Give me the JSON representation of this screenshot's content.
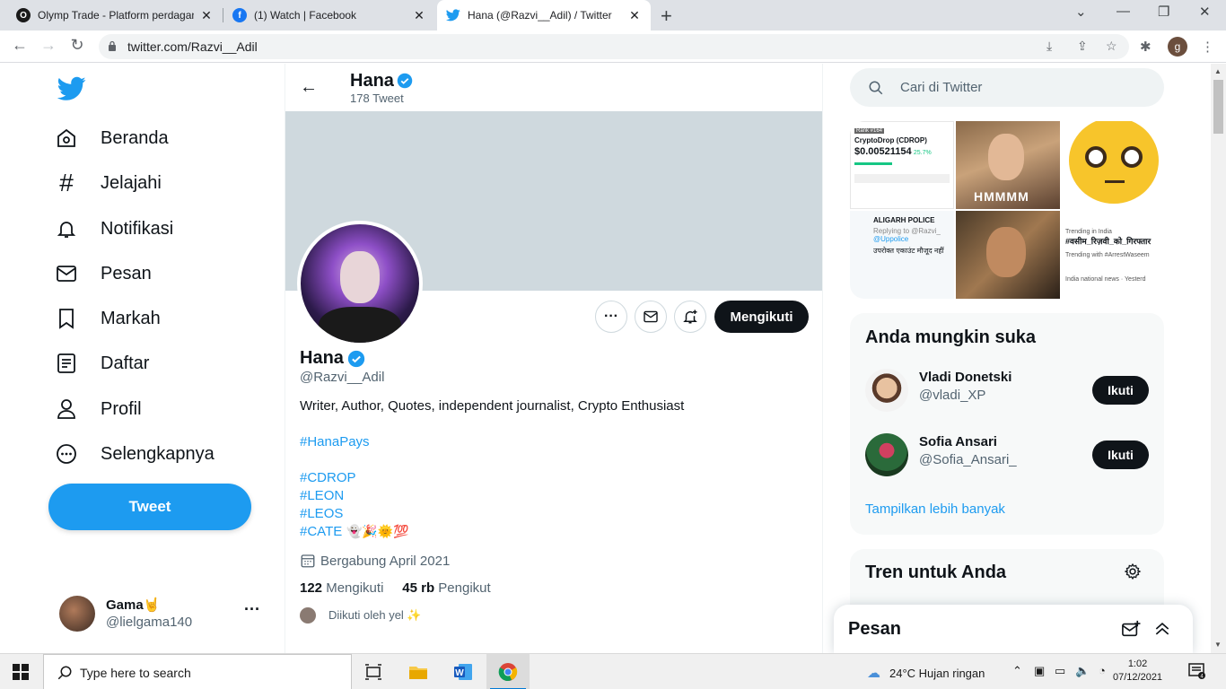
{
  "browser": {
    "tabs": [
      {
        "title": "Olymp Trade - Platform perdagangan",
        "icon": "olymp-icon"
      },
      {
        "title": "(1) Watch | Facebook",
        "icon": "facebook-icon"
      },
      {
        "title": "Hana (@Razvi__Adil) / Twitter",
        "icon": "twitter-icon"
      }
    ],
    "url": "twitter.com/Razvi__Adil",
    "profile_initial": "g"
  },
  "nav": {
    "items": [
      {
        "label": "Beranda",
        "icon": "home-icon"
      },
      {
        "label": "Jelajahi",
        "icon": "hashtag-icon"
      },
      {
        "label": "Notifikasi",
        "icon": "bell-icon"
      },
      {
        "label": "Pesan",
        "icon": "mail-icon"
      },
      {
        "label": "Markah",
        "icon": "bookmark-icon"
      },
      {
        "label": "Daftar",
        "icon": "list-icon"
      },
      {
        "label": "Profil",
        "icon": "user-icon"
      },
      {
        "label": "Selengkapnya",
        "icon": "more-circle-icon"
      }
    ],
    "tweet_label": "Tweet",
    "account": {
      "name": "Gama🤘",
      "handle": "@lielgama140"
    }
  },
  "profile": {
    "header_name": "Hana",
    "tweet_count": "178 Tweet",
    "name": "Hana",
    "handle": "@Razvi__Adil",
    "bio": "Writer, Author, Quotes, independent journalist, Crypto Enthusiast",
    "hashtags": [
      "#HanaPays",
      "#CDROP",
      "#LEON",
      "#LEOS",
      "#CATE"
    ],
    "cate_emoji": "👻🎉🌞💯",
    "joined": "Bergabung April 2021",
    "following_count": "122",
    "following_label": "Mengikuti",
    "followers_count": "45 rb",
    "followers_label": "Pengikut",
    "followed_by": "Diikuti oleh yel ✨",
    "following_button": "Mengikuti"
  },
  "sidebar": {
    "search_placeholder": "Cari di Twitter",
    "media": {
      "crypto_rank": "Rank #164",
      "crypto_name": "CryptoDrop (CDROP)",
      "crypto_price": "$0.00521154",
      "crypto_change": "25.7%",
      "hmmm": "HMMMM",
      "police_name": "ALIGARH POLICE",
      "police_reply": "Replying to @Razvi_",
      "police_mention": "@Uppolice",
      "police_text": "उपरोक्त एकाउंट मौजूद नहीं",
      "trend_label": "Trending in India",
      "trend_tag": "#वसीम_रिज़वी_को_गिरफ्तार",
      "trend_with": "Trending with #ArrestWaseem",
      "trend_news": "India national news · Yesterd"
    },
    "who_to_follow": {
      "title": "Anda mungkin suka",
      "users": [
        {
          "name": "Vladi Donetski",
          "handle": "@vladi_XP",
          "button": "Ikuti"
        },
        {
          "name": "Sofia Ansari",
          "handle": "@Sofia_Ansari_",
          "button": "Ikuti"
        }
      ],
      "show_more": "Tampilkan lebih banyak"
    },
    "trends_title": "Tren untuk Anda"
  },
  "messages": {
    "title": "Pesan"
  },
  "taskbar": {
    "search_placeholder": "Type here to search",
    "weather": "24°C  Hujan ringan",
    "time": "1:02",
    "date": "07/12/2021",
    "notification_count": "4"
  },
  "colors": {
    "twitter_blue": "#1d9bf0",
    "text_dark": "#0f1419",
    "text_muted": "#536471"
  }
}
